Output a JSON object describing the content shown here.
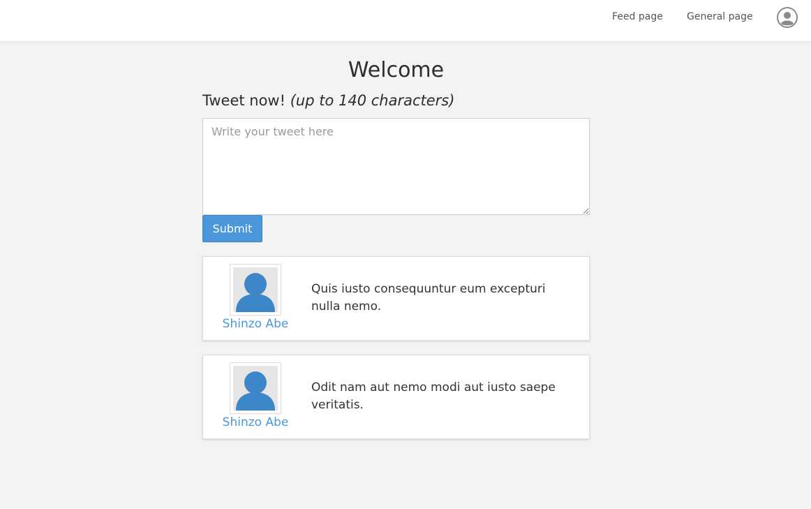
{
  "nav": {
    "links": [
      {
        "label": "Feed page"
      },
      {
        "label": "General page"
      }
    ],
    "avatar_icon": "user-circle-icon"
  },
  "main": {
    "title": "Welcome",
    "tweet_heading": "Tweet now!",
    "tweet_limit_note": "(up to 140 characters)",
    "tweet_input": {
      "placeholder": "Write your tweet here",
      "value": ""
    },
    "submit_label": "Submit"
  },
  "tweets": [
    {
      "author": "Shinzo Abe",
      "text": "Quis iusto consequuntur eum excepturi nulla nemo.",
      "avatar_icon": "user-avatar-icon"
    },
    {
      "author": "Shinzo Abe",
      "text": "Odit nam aut nemo modi aut iusto saepe veritatis.",
      "avatar_icon": "user-avatar-icon"
    }
  ],
  "colors": {
    "accent": "#4a97d9",
    "avatar_fill": "#3d87c9",
    "background": "#f3f3f3"
  }
}
